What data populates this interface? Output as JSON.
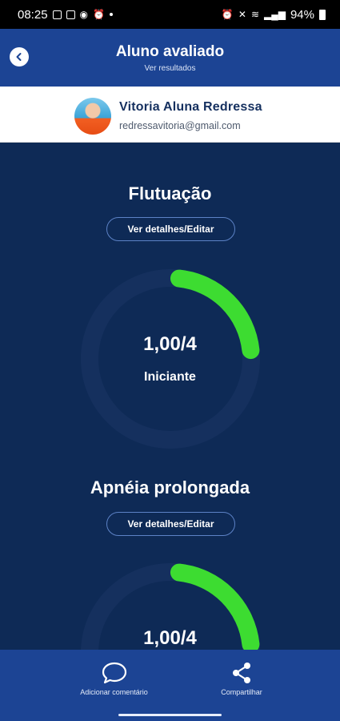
{
  "status_bar": {
    "time": "08:25",
    "battery": "94%"
  },
  "header": {
    "title": "Aluno avaliado",
    "subtitle": "Ver resultados"
  },
  "student": {
    "name": "Vitoria Aluna Redressa",
    "email": "redressavitoria@gmail.com"
  },
  "evaluations": [
    {
      "title": "Flutuação",
      "button_label": "Ver detalhes/Editar",
      "score_text": "1,00/4",
      "level": "Iniciante",
      "score": 1,
      "max": 4
    },
    {
      "title": "Apnéia prolongada",
      "button_label": "Ver detalhes/Editar",
      "score_text": "1,00/4",
      "score": 1,
      "max": 4
    }
  ],
  "bottom_bar": {
    "comment_label": "Adicionar comentário",
    "share_label": "Compartilhar"
  },
  "colors": {
    "header": "#1c4494",
    "background": "#0e2a56",
    "gauge_fill": "#3ddc31",
    "gauge_track": "#15305e"
  },
  "icons": {
    "back": "chevron-left-icon",
    "comment": "speech-bubble-icon",
    "share": "share-icon"
  }
}
